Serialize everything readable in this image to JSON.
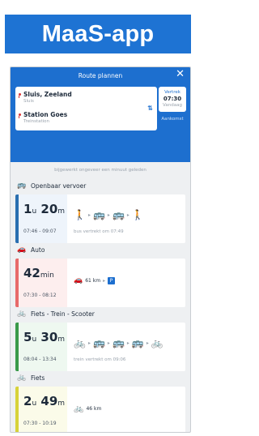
{
  "banner": {
    "title": "MaaS-app"
  },
  "header": {
    "title": "Route plannen",
    "close_icon": "close-icon"
  },
  "route": {
    "from": {
      "name": "Sluis, Zeeland",
      "sub": "Sluis"
    },
    "to": {
      "name": "Station Goes",
      "sub": "Treinstation"
    },
    "depart_label": "Vertrek",
    "depart_time": "07:30",
    "depart_day": "Vandaag",
    "arrive_label": "Aankomst"
  },
  "updated_text": "bijgewerkt ongeveer een minuut geleden",
  "options": [
    {
      "title": "Openbaar vervoer",
      "icon": "bus-train-icon",
      "duration_main": "1",
      "duration_unit1": "u",
      "duration_min": "20",
      "duration_unit2": "m",
      "times": "07:46 - 09:07",
      "note": "bus vertrekt om 07:49",
      "legs": [
        "walk",
        "bus",
        "bus",
        "walk"
      ],
      "stripe": "#2a6fb0"
    },
    {
      "title": "Auto",
      "icon": "car-icon",
      "duration_main": "42",
      "duration_unit1": "min",
      "duration_min": "",
      "duration_unit2": "",
      "times": "07:30 - 08:12",
      "note": "",
      "distance": "61 km",
      "legs": [
        "car",
        "parking"
      ],
      "stripe": "#e76a6a"
    },
    {
      "title": "Fiets - Trein - Scooter",
      "icon": "bike-train-scooter-icon",
      "duration_main": "5",
      "duration_unit1": "u",
      "duration_min": "30",
      "duration_unit2": "m",
      "times": "08:04 - 13:34",
      "note": "trein vertrekt om 09:06",
      "legs": [
        "bike",
        "bus",
        "bus",
        "bus",
        "bike"
      ],
      "stripe": "#3a9a4a"
    },
    {
      "title": "Fiets",
      "icon": "bike-icon",
      "duration_main": "2",
      "duration_unit1": "u",
      "duration_min": "49",
      "duration_unit2": "m",
      "times": "07:30 - 10:19",
      "note": "",
      "distance": "46 km",
      "legs": [
        "bike"
      ],
      "stripe": "#d7d23a"
    }
  ]
}
